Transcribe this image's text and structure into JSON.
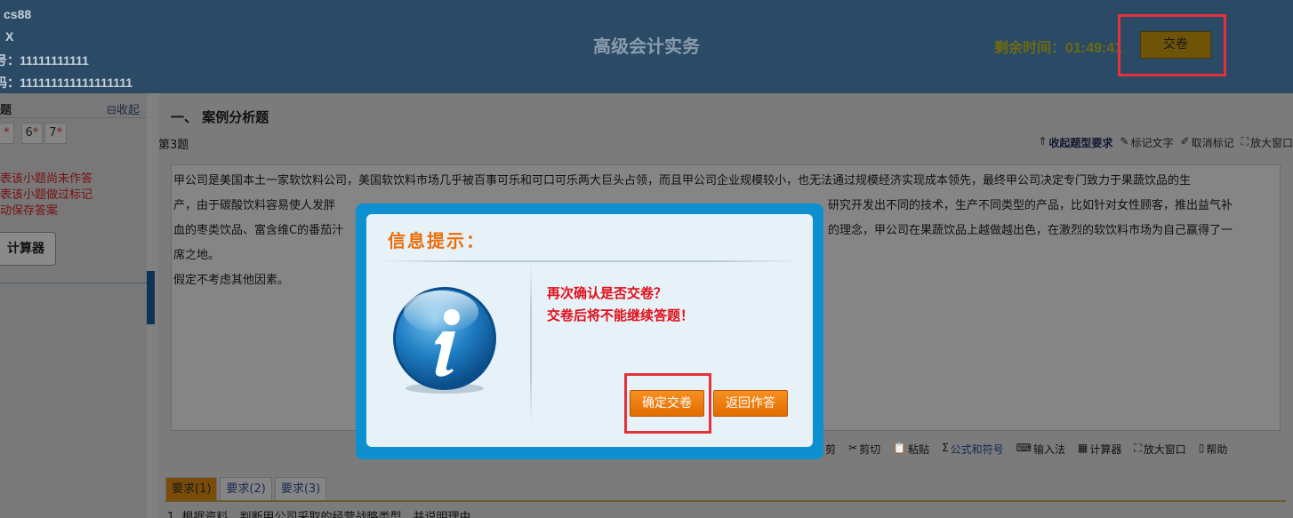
{
  "header": {
    "user_line": "cs88",
    "x_line": "X",
    "id_line": "号：11111111111",
    "code_line": "码：111111111111111111",
    "title": "高级会计实务",
    "timer": "剩余时间：01:49:41",
    "submit_label": "交卷"
  },
  "left_panel": {
    "title": "题",
    "collapse_label": "⊟收起",
    "numbers": [
      {
        "num": "",
        "star": "*"
      },
      {
        "num": "6",
        "star": "*"
      },
      {
        "num": "7",
        "star": "*"
      }
    ],
    "legend": [
      "表该小题尚未作答",
      "表该小题做过标记",
      "动保存答案"
    ],
    "calculator_label": "计算器"
  },
  "main": {
    "section_title": "一、 案例分析题",
    "question_number": "第3题",
    "toolbar": {
      "collapse": "收起题型要求",
      "mark": "标记文字",
      "unmark": "取消标记",
      "enlarge": "放大窗口"
    },
    "question_lines": [
      "甲公司是美国本土一家软饮料公司，美国软饮料市场几乎被百事可乐和可口可乐两大巨头占领，而且甲公司企业规模较小，也无法通过规模经济实现成本领先，最终甲公司决定专门致力于果蔬饮品的生",
      "产，由于碳酸饮料容易使人发胖",
      "研究开发出不同的技术，生产不同类型的产品，比如针对女性顾客，推出益气补",
      "血的枣类饮品、富含维C的番茄汁",
      "的理念，甲公司在果蔬饮品上越做越出色，在激烈的软饮料市场为自己赢得了一",
      "席之地。",
      "假定不考虑其他因素。"
    ],
    "answer_toolbar": {
      "cut_partial": "剪",
      "cut": "剪切",
      "paste": "粘贴",
      "formula": "公式和符号",
      "ime": "输入法",
      "calculator": "计算器",
      "enlarge": "放大窗口",
      "help": "帮助"
    },
    "tabs": [
      "要求(1)",
      "要求(2)",
      "要求(3)"
    ],
    "requirement_text": "1. 根据资料，判断甲公司采取的经营战略类型，并说明理由"
  },
  "modal": {
    "title": "信息提示：",
    "line1": "再次确认是否交卷？",
    "line2": "交卷后将不能继续答题！",
    "confirm_label": "确定交卷",
    "back_label": "返回作答"
  }
}
